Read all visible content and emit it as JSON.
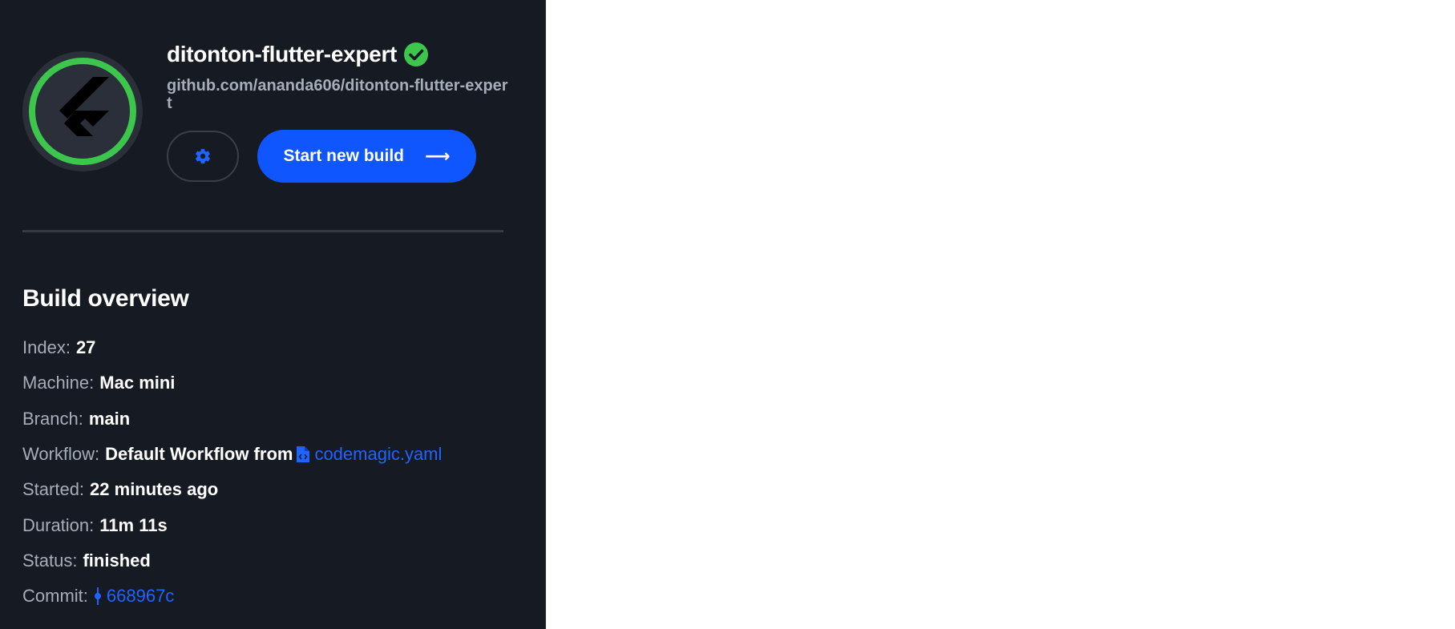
{
  "app": {
    "title": "ditonton-flutter-expert",
    "repo_url": "github.com/ananda606/ditonton-flutter-expert",
    "status_icon": "check-circle-icon",
    "logo_icon": "flutter-logo-icon"
  },
  "actions": {
    "settings_icon": "gear-icon",
    "start_build_label": "Start new build",
    "start_build_arrow": "⟶"
  },
  "overview": {
    "title": "Build overview",
    "index_label": "Index:",
    "index_value": "27",
    "machine_label": "Machine:",
    "machine_value": "Mac mini",
    "branch_label": "Branch:",
    "branch_value": "main",
    "workflow_label": "Workflow:",
    "workflow_value": "Default Workflow from",
    "workflow_file": "codemagic.yaml",
    "started_label": "Started:",
    "started_value": "22 minutes ago",
    "duration_label": "Duration:",
    "duration_value": "11m 11s",
    "status_label": "Status:",
    "status_value": "finished",
    "commit_label": "Commit:",
    "commit_value": "668967c"
  },
  "colors": {
    "panel_bg": "#161a22",
    "accent_blue": "#0f56ff",
    "link_blue": "#1f64ff",
    "success_green": "#3cc64c",
    "muted_text": "#a7adb8"
  }
}
